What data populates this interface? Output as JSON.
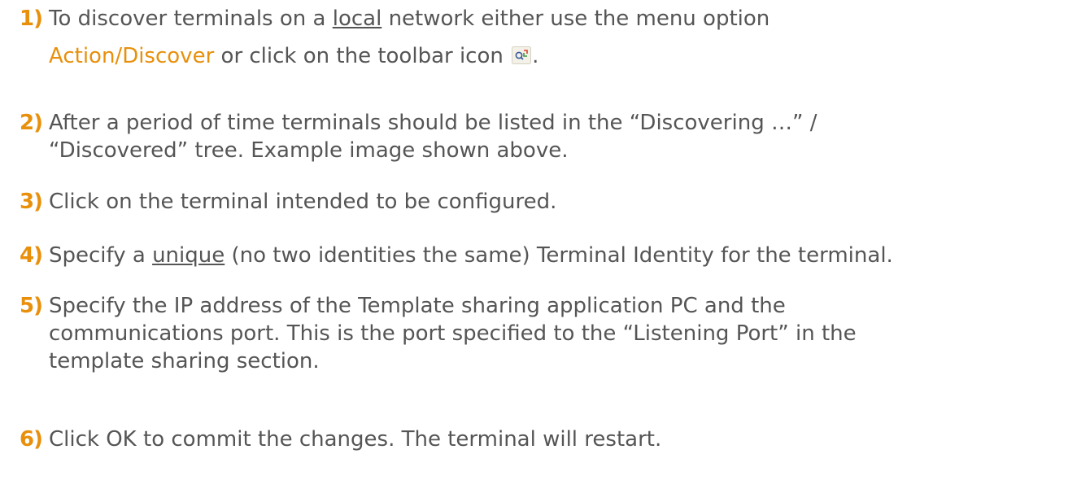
{
  "steps": [
    {
      "num": "1)",
      "l1_a": "To discover terminals on a ",
      "l1_u": "local",
      "l1_b": " network either use the menu option",
      "l2_hl": "Action/Discover",
      "l2_b": " or click on the toolbar icon ",
      "l2_c": ".",
      "icon": "discover-icon"
    },
    {
      "num": "2)",
      "l1": "After a period of time terminals should be listed in the “Discovering …” /",
      "l2": "“Discovered” tree. Example image shown above."
    },
    {
      "num": "3)",
      "l1": "Click on the terminal intended to be configured."
    },
    {
      "num": "4)",
      "l1_a": "Specify a ",
      "l1_u": "unique",
      "l1_b": " (no two identities the same) Terminal Identity for the terminal."
    },
    {
      "num": "5)",
      "l1": "Specify the IP address of the Template sharing application PC and the",
      "l2": "communications port. This is the port specified to the “Listening Port” in the",
      "l3": "template sharing section."
    },
    {
      "num": "6)",
      "l1": "Click OK to commit the changes. The terminal will restart."
    }
  ],
  "colors": {
    "text": "#555555",
    "accent": "#e8900c"
  }
}
